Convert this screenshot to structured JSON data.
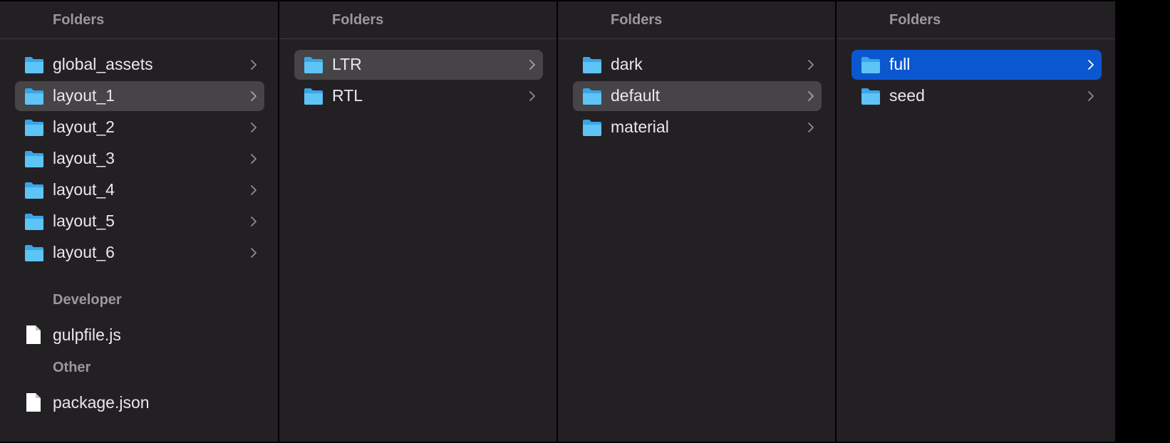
{
  "columns": [
    {
      "header": "Folders",
      "folders": [
        {
          "label": "global_assets",
          "state": "none"
        },
        {
          "label": "layout_1",
          "state": "dim"
        },
        {
          "label": "layout_2",
          "state": "none"
        },
        {
          "label": "layout_3",
          "state": "none"
        },
        {
          "label": "layout_4",
          "state": "none"
        },
        {
          "label": "layout_5",
          "state": "none"
        },
        {
          "label": "layout_6",
          "state": "none"
        }
      ],
      "sections": [
        {
          "title": "Developer",
          "files": [
            "gulpfile.js"
          ]
        },
        {
          "title": "Other",
          "files": [
            "package.json"
          ]
        }
      ]
    },
    {
      "header": "Folders",
      "folders": [
        {
          "label": "LTR",
          "state": "dim"
        },
        {
          "label": "RTL",
          "state": "none"
        }
      ]
    },
    {
      "header": "Folders",
      "folders": [
        {
          "label": "dark",
          "state": "none"
        },
        {
          "label": "default",
          "state": "dim"
        },
        {
          "label": "material",
          "state": "none"
        }
      ]
    },
    {
      "header": "Folders",
      "folders": [
        {
          "label": "full",
          "state": "active"
        },
        {
          "label": "seed",
          "state": "none"
        }
      ]
    }
  ],
  "icons": {
    "folder": "folder-icon",
    "file": "file-icon",
    "chevron": "chevron-right-icon"
  },
  "colors": {
    "background": "#232024",
    "divider": "#000000",
    "header_text": "#9a989b",
    "item_text": "#e9e8ea",
    "selection_inactive": "#464447",
    "selection_active": "#0b57d0",
    "folder_icon": "#4fb6f0"
  }
}
